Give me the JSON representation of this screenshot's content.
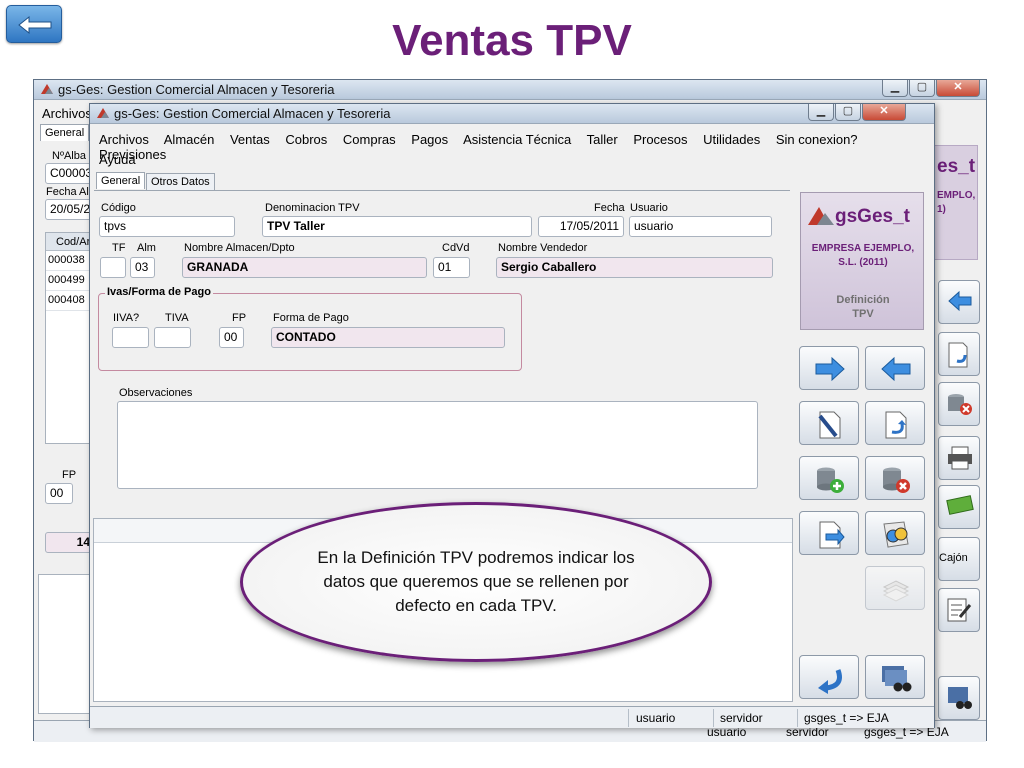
{
  "slide": {
    "title": "Ventas TPV",
    "back_icon": "back-arrow-icon"
  },
  "background_window": {
    "title": "gs-Ges: Gestion Comercial Almacen y Tesoreria",
    "menu_first": "Archivos",
    "tab_general": "General",
    "label_nalbaran": "NºAlba",
    "field_nalbaran": "C00003",
    "label_fecha": "Fecha Al",
    "field_fecha": "20/05/2",
    "col_header": "Cod/Ar",
    "rows": [
      "000038",
      "000499",
      "000408"
    ],
    "label_fp": "FP",
    "field_fp": "00",
    "field_count": "14",
    "logo_partial": "es_t",
    "empresa_partial_1": "EMPLO,",
    "empresa_partial_2": "1)",
    "btn_cajon": "Cajón",
    "status_usuario": "usuario",
    "status_servidor": "servidor",
    "status_db": "gsges_t => EJA"
  },
  "window": {
    "title": "gs-Ges: Gestion Comercial Almacen y Tesoreria",
    "menu": [
      "Archivos",
      "Almacén",
      "Ventas",
      "Cobros",
      "Compras",
      "Pagos",
      "Asistencia Técnica",
      "Taller",
      "Procesos",
      "Utilidades",
      "Sin conexion?",
      "Previsiones"
    ],
    "menu_ayuda": "Ayuda",
    "tabs": [
      "General",
      "Otros Datos"
    ]
  },
  "form": {
    "codigo_label": "Código",
    "codigo": "tpvs",
    "denominacion_label": "Denominacion TPV",
    "denominacion": "TPV Taller",
    "fecha_label": "Fecha",
    "fecha": "17/05/2011",
    "usuario_label": "Usuario",
    "usuario": "usuario",
    "tf_label": "TF",
    "tf": "",
    "alm_label": "Alm",
    "alm": "03",
    "nombre_almacen_label": "Nombre Almacen/Dpto",
    "nombre_almacen": "GRANADA",
    "cdvd_label": "CdVd",
    "cdvd": "01",
    "nombre_vendedor_label": "Nombre Vendedor",
    "nombre_vendedor": "Sergio Caballero",
    "ivas_group": "Ivas/Forma de Pago",
    "iiva_label": "IIVA?",
    "iiva": "",
    "tiva_label": "TIVA",
    "tiva": "",
    "fp_label": "FP",
    "fp": "00",
    "forma_pago_label": "Forma de Pago",
    "forma_pago": "CONTADO",
    "observaciones_label": "Observaciones",
    "observaciones": ""
  },
  "logo_panel": {
    "brand": "gsGes_t",
    "empresa_line1": "EMPRESA EJEMPLO,",
    "empresa_line2": "S.L. (2011)",
    "desc_line1": "Definición",
    "desc_line2": "TPV"
  },
  "toolbar_buttons": [
    {
      "name": "next-record-button",
      "icon": "arrow-right-icon"
    },
    {
      "name": "previous-record-button",
      "icon": "arrow-left-icon"
    },
    {
      "name": "edit-button",
      "icon": "pen-document-icon"
    },
    {
      "name": "undo-document-button",
      "icon": "undo-document-icon"
    },
    {
      "name": "add-record-button",
      "icon": "database-add-icon"
    },
    {
      "name": "delete-record-button",
      "icon": "database-delete-icon"
    },
    {
      "name": "export-button",
      "icon": "document-export-icon"
    },
    {
      "name": "search-button",
      "icon": "search-binoculars-icon"
    },
    {
      "name": "print-button",
      "icon": "printer-icon"
    },
    {
      "name": "exit-button",
      "icon": "return-arrow-icon"
    },
    {
      "name": "list-search-button",
      "icon": "list-binoculars-icon"
    }
  ],
  "statusbar": {
    "usuario": "usuario",
    "servidor": "servidor",
    "db": "gsges_t => EJA"
  },
  "callout": {
    "text": "En la Definición TPV podremos indicar los datos que queremos que se rellenen por defecto en cada TPV."
  },
  "colors": {
    "title_purple": "#6b1f78",
    "readonly_field": "#f1e6ee",
    "group_border": "#c48aa0",
    "button_blue": "#2f76c2"
  }
}
